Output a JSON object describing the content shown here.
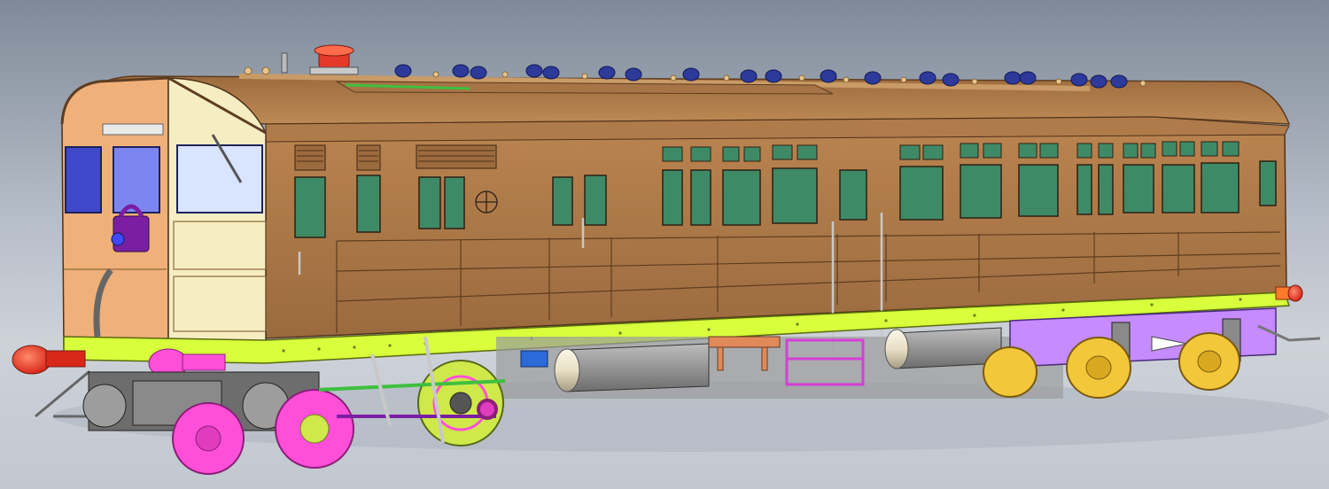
{
  "scene": {
    "subject": "railcar-cad-model",
    "colors": {
      "background_top": "#7f8a99",
      "background_bottom": "#c7ccd4",
      "body_brown": "#a9764a",
      "body_dark": "#8d5f37",
      "cab_cream": "#f6eec2",
      "cab_peach": "#f0b07a",
      "window_green": "#3f8a66",
      "underframe_lime": "#d7ff3c",
      "wheel_magenta": "#ff4fd8",
      "bogie_violet": "#c58bff",
      "wheel_yellow": "#f2c73a",
      "tank_cream": "#ede6cf",
      "lamp_red": "#ff4a2a",
      "vent_blue": "#2d3a9a",
      "cab_window_blue": "#3f49c9"
    }
  }
}
